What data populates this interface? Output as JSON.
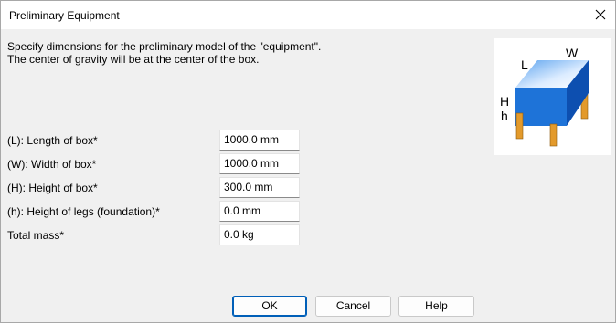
{
  "window": {
    "title": "Preliminary Equipment"
  },
  "description": {
    "line1": "Specify dimensions for the preliminary model of the \"equipment\".",
    "line2": "The center of gravity will be at the center of the box."
  },
  "preview": {
    "labels": {
      "L": "L",
      "W": "W",
      "H": "H",
      "h": "h"
    },
    "colors": {
      "box_front": "#1e73d8",
      "box_side": "#0d4fb0",
      "box_top": "#a9d3ff",
      "legs": "#e39a2b"
    }
  },
  "fields": [
    {
      "label": "(L): Length of box*",
      "value": "1000.0 mm"
    },
    {
      "label": "(W): Width of box*",
      "value": "1000.0 mm"
    },
    {
      "label": "(H): Height of box*",
      "value": "300.0 mm"
    },
    {
      "label": "(h): Height of legs (foundation)*",
      "value": "0.0 mm"
    },
    {
      "label": "Total mass*",
      "value": "0.0 kg"
    }
  ],
  "buttons": {
    "ok": "OK",
    "cancel": "Cancel",
    "help": "Help"
  }
}
